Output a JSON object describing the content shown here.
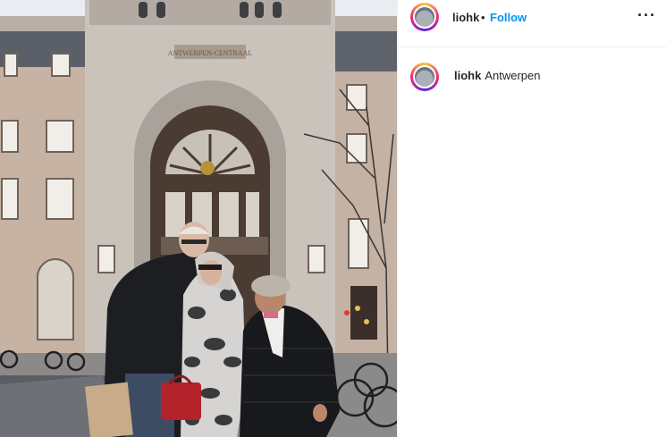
{
  "post": {
    "image_alt": "Photo of four people in winter coats in front of Antwerpen Centraal station",
    "station_sign": "ANTWERPEN-CENTRAAL"
  },
  "header": {
    "username": "liohk",
    "separator": "•",
    "follow_label": "Follow",
    "more_icon": "more-options-icon",
    "more_glyph": "···"
  },
  "caption": {
    "username": "liohk",
    "text": "Antwerpen"
  },
  "colors": {
    "follow_blue": "#0095f6",
    "text_dark": "#262626",
    "divider": "#efefef"
  }
}
